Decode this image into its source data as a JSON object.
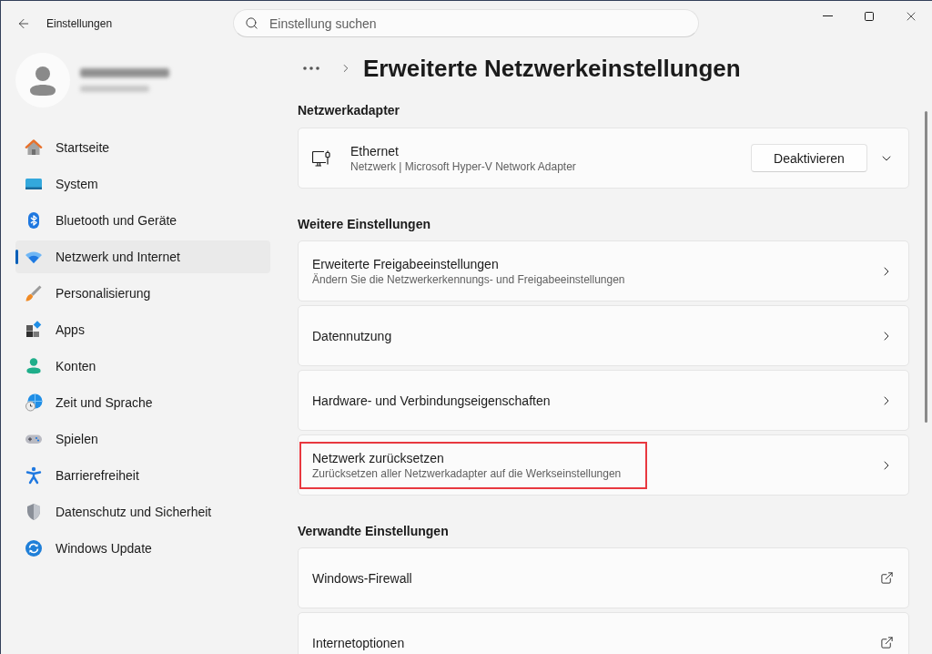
{
  "window": {
    "title": "Einstellungen"
  },
  "search": {
    "placeholder": "Einstellung suchen"
  },
  "sidebar": {
    "items": [
      {
        "label": "Startseite",
        "selected": false
      },
      {
        "label": "System",
        "selected": false
      },
      {
        "label": "Bluetooth und Geräte",
        "selected": false
      },
      {
        "label": "Netzwerk und Internet",
        "selected": true
      },
      {
        "label": "Personalisierung",
        "selected": false
      },
      {
        "label": "Apps",
        "selected": false
      },
      {
        "label": "Konten",
        "selected": false
      },
      {
        "label": "Zeit und Sprache",
        "selected": false
      },
      {
        "label": "Spielen",
        "selected": false
      },
      {
        "label": "Barrierefreiheit",
        "selected": false
      },
      {
        "label": "Datenschutz und Sicherheit",
        "selected": false
      },
      {
        "label": "Windows Update",
        "selected": false
      }
    ]
  },
  "page": {
    "title": "Erweiterte Netzwerkeinstellungen"
  },
  "sections": [
    {
      "heading": "Netzwerkadapter",
      "cards": [
        {
          "kind": "adapter",
          "title": "Ethernet",
          "subtitle": "Netzwerk | Microsoft Hyper-V Network Adapter",
          "button": "Deaktivieren",
          "expanded": false
        }
      ]
    },
    {
      "heading": "Weitere Einstellungen",
      "cards": [
        {
          "kind": "navigate",
          "title": "Erweiterte Freigabeeinstellungen",
          "subtitle": "Ändern Sie die Netzwerkerkennungs- und Freigabeeinstellungen",
          "highlighted": false
        },
        {
          "kind": "navigate",
          "title": "Datennutzung",
          "highlighted": false
        },
        {
          "kind": "navigate",
          "title": "Hardware- und Verbindungseigenschaften",
          "highlighted": false
        },
        {
          "kind": "navigate",
          "title": "Netzwerk zurücksetzen",
          "subtitle": "Zurücksetzen aller Netzwerkadapter auf die Werkseinstellungen",
          "highlighted": true
        }
      ]
    },
    {
      "heading": "Verwandte Einstellungen",
      "cards": [
        {
          "kind": "external",
          "title": "Windows-Firewall",
          "highlighted": false
        },
        {
          "kind": "external",
          "title": "Internetoptionen",
          "highlighted": false
        }
      ]
    }
  ]
}
